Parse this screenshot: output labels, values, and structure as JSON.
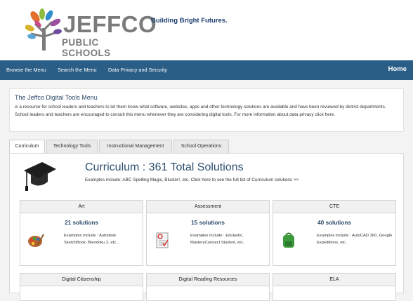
{
  "header": {
    "logo_word": "JEFFCO",
    "logo_sub": "PUBLIC SCHOOLS",
    "tagline": "Building Bright Futures."
  },
  "nav": {
    "items": [
      "Browse the Menu",
      "Search the Menu",
      "Data Privacy and Security"
    ],
    "home": "Home"
  },
  "intro": {
    "title": "The Jeffco Digital Tools Menu",
    "text": "is a resource for school leaders and teachers to let them know what software, websites, apps and other technology solutions are available and have been reviewed by district departments. School leaders and teachers are encouraged to consult this menu whenever they are considering digital tools. For more information about data privacy click here."
  },
  "tabs": [
    "Curriculum",
    "Technology Tools",
    "Instructional Management",
    "School Operations"
  ],
  "category": {
    "title": "Curriculum : 361 Total Solutions",
    "desc": "Examples include: ABC Spelling Magic, Bluster!, etc. Click here to see the full list of Curriculum solutions >>"
  },
  "cards": [
    {
      "title": "Art",
      "count": "21 solutions",
      "examples": "Examples include : Autodesk SketchBook, Blendoku 2, etc..."
    },
    {
      "title": "Assessment",
      "count": "15 solutions",
      "examples": "Examples include : Edulastic, MasteryConnect Student, etc.."
    },
    {
      "title": "CTE",
      "count": "40 solutions",
      "examples": "Examples include : AutoCAD 360, Google Expeditions, etc.."
    },
    {
      "title": "Digital Citizenship",
      "count": "",
      "examples": ""
    },
    {
      "title": "Digital Reading Resources",
      "count": "",
      "examples": ""
    },
    {
      "title": "ELA",
      "count": "",
      "examples": ""
    }
  ],
  "colors": {
    "nav": "#2b5e86",
    "title_text": "#2f4f6f"
  },
  "icons": [
    "graduation-cap-icon",
    "palette-icon",
    "test-paper-icon",
    "backpack-icon"
  ]
}
